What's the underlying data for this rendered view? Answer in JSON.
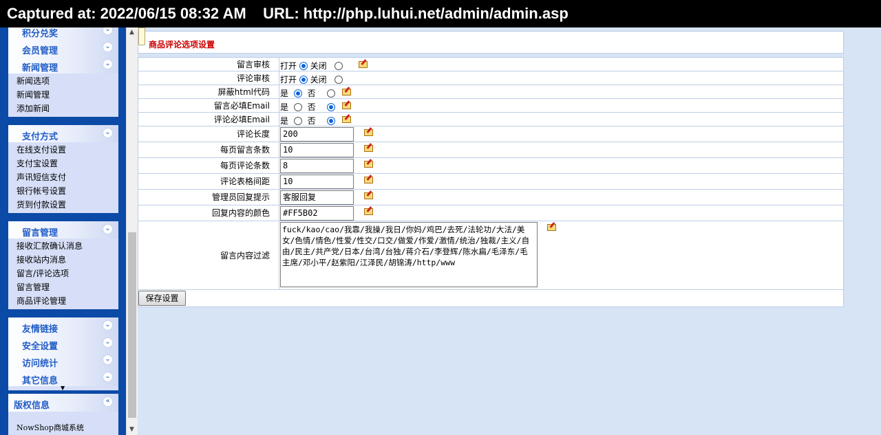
{
  "capture": {
    "text": "Captured at: 2022/06/15 08:32 AM    URL: http://php.luhui.net/admin/admin.asp"
  },
  "sidebar": {
    "group1": {
      "heads": [
        "积分兑奖",
        "会员管理",
        "新闻管理"
      ],
      "items": [
        "新闻选项",
        "新闻管理",
        "添加新闻"
      ]
    },
    "group2": {
      "head": "支付方式",
      "items": [
        "在线支付设置",
        "支付宝设置",
        "声讯短信支付",
        "银行帐号设置",
        "货到付款设置"
      ]
    },
    "group3": {
      "head": "留言管理",
      "items": [
        "接收汇款确认消息",
        "接收站内消息",
        "留言/评论选项",
        "留言管理",
        "商品评论管理"
      ]
    },
    "group4": {
      "heads": [
        "友情链接",
        "安全设置",
        "访问统计",
        "其它信息"
      ]
    },
    "group5": {
      "head": "版权信息",
      "items": [
        "NowShop商城系统"
      ]
    }
  },
  "page": {
    "title": "商品评论选项设置"
  },
  "form": {
    "on_label": "打开",
    "off_label": "关闭",
    "yes_label": "是",
    "no_label": "否",
    "rows": [
      {
        "label": "留言审核",
        "value": "on"
      },
      {
        "label": "评论审核",
        "value": "on"
      },
      {
        "label": "屏蔽html代码",
        "value": "yes"
      },
      {
        "label": "留言必填Email",
        "value": "no"
      },
      {
        "label": "评论必填Email",
        "value": "no"
      }
    ],
    "inputs": [
      {
        "label": "评论长度",
        "value": "200"
      },
      {
        "label": "每页留言条数",
        "value": "10"
      },
      {
        "label": "每页评论条数",
        "value": "8"
      },
      {
        "label": "评论表格间距",
        "value": "10"
      },
      {
        "label": "管理员回复提示",
        "value": "客服回复"
      },
      {
        "label": "回复内容的颜色",
        "value": "#FF5B02"
      }
    ],
    "filter": {
      "label": "留言内容过滤",
      "value": "fuck/kao/cao/我靠/我操/我日/你妈/鸡巴/去死/法轮功/大法/美女/色情/情色/性爱/性交/口交/做爱/作爱/激情/统治/独裁/主义/自由/民主/共产党/日本/台湾/台独/蒋介石/李登辉/陈水扁/毛泽东/毛主席/邓小平/赵紫阳/江泽民/胡锦涛/http/www"
    },
    "save_label": "保存设置"
  }
}
